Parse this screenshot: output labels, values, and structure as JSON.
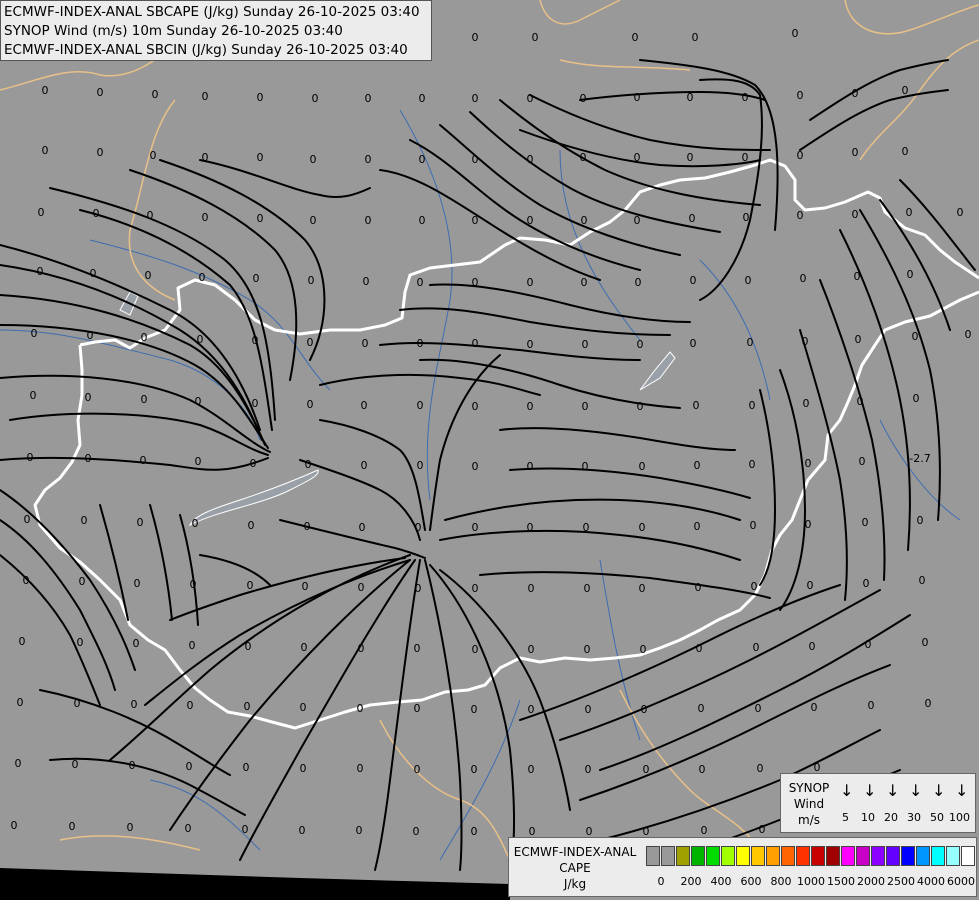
{
  "title_lines": [
    "ECMWF-INDEX-ANAL SBCAPE (J/kg) Sunday 26-10-2025 03:40",
    "SYNOP Wind (m/s) 10m Sunday 26-10-2025 03:40",
    "ECMWF-INDEX-ANAL SBCIN (J/kg) Sunday 26-10-2025 03:40"
  ],
  "colors": {
    "background": "#999999",
    "streamline": "#000000",
    "country_border": "#ffffff",
    "admin_border": "#e8c088",
    "river": "#3d6db0",
    "water": "#9aa0a8",
    "label_text": "#000000"
  },
  "map": {
    "field_labels": {
      "default_value": "0",
      "special_value": "-2.7"
    }
  },
  "synop_legend": {
    "title": "SYNOP\nWind\nm/s",
    "title_lines": [
      "SYNOP",
      "Wind",
      "m/s"
    ],
    "arrow_icon": "down-arrow-icon",
    "values": [
      "5",
      "10",
      "20",
      "30",
      "50",
      "100"
    ]
  },
  "cape_legend": {
    "title_lines": [
      "ECMWF-INDEX-ANAL",
      "CAPE",
      "J/kg"
    ],
    "swatch_colors": [
      "#999999",
      "#999999",
      "#a0a000",
      "#00b400",
      "#00dc00",
      "#a0ff00",
      "#ffff00",
      "#ffc800",
      "#ffa000",
      "#ff6400",
      "#ff3200",
      "#c80000",
      "#a00000",
      "#ff00ff",
      "#c800c8",
      "#8c00ff",
      "#6400ff",
      "#0000ff",
      "#0096ff",
      "#00ffff",
      "#96ffff",
      "#ffffff"
    ],
    "tick_labels": [
      "0",
      "200",
      "400",
      "600",
      "800",
      "1000",
      "1500",
      "2000",
      "2500",
      "4000",
      "6000"
    ]
  }
}
